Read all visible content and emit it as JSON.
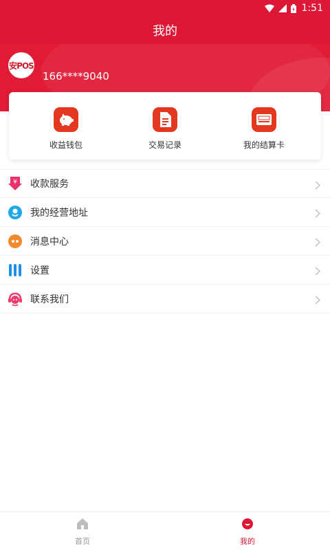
{
  "status": {
    "time": "1:51"
  },
  "header": {
    "title": "我的"
  },
  "profile": {
    "avatar_text": "安POS",
    "phone": "166****9040"
  },
  "quick": [
    {
      "label": "收益钱包",
      "icon": "piggy-bank-icon"
    },
    {
      "label": "交易记录",
      "icon": "document-icon"
    },
    {
      "label": "我的结算卡",
      "icon": "card-icon"
    }
  ],
  "menu": [
    {
      "label": "收款服务",
      "icon": "yuan-download-icon",
      "color": "#e8336a"
    },
    {
      "label": "我的经营地址",
      "icon": "location-icon",
      "color": "#1fa7e6"
    },
    {
      "label": "消息中心",
      "icon": "chat-bubble-icon",
      "color": "#f28a2c"
    },
    {
      "label": "设置",
      "icon": "settings-bars-icon",
      "color": "#1f8fe6"
    },
    {
      "label": "联系我们",
      "icon": "customer-service-icon",
      "color": "#ea3e6d"
    }
  ],
  "tabs": {
    "home": "首页",
    "me": "我的"
  },
  "colors": {
    "primary": "#dd1836",
    "card_icon": "#e3381f"
  }
}
